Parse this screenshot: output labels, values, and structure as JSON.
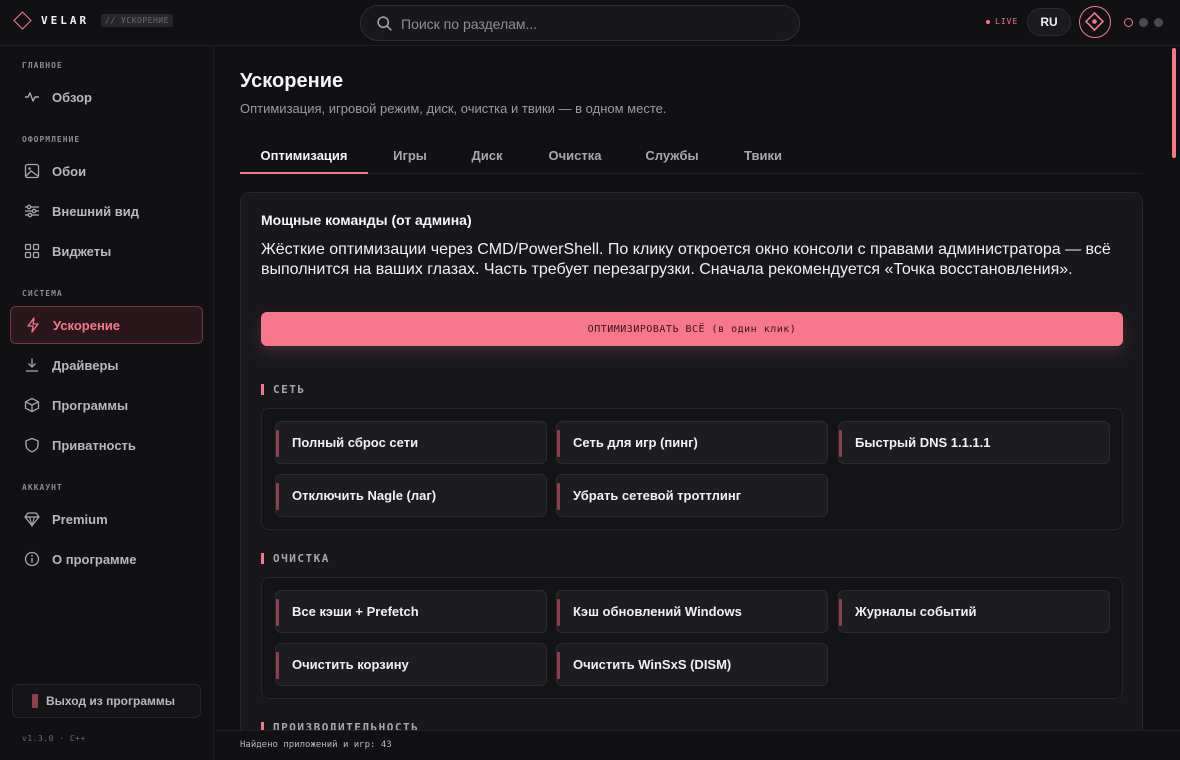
{
  "app": {
    "brand": "VELAR",
    "crumb": "// УСКОРЕНИЕ",
    "live": "LIVE",
    "language": "RU",
    "accent_color": "#f5788a"
  },
  "search": {
    "placeholder": "Поиск по разделам..."
  },
  "sidebar": {
    "sections": [
      {
        "title": "ГЛАВНОЕ",
        "items": [
          {
            "label": "Обзор",
            "icon": "activity-icon"
          }
        ]
      },
      {
        "title": "ОФОРМЛЕНИЕ",
        "items": [
          {
            "label": "Обои",
            "icon": "image-icon"
          },
          {
            "label": "Внешний вид",
            "icon": "sliders-icon"
          },
          {
            "label": "Виджеты",
            "icon": "grid-icon"
          }
        ]
      },
      {
        "title": "СИСТЕМА",
        "items": [
          {
            "label": "Ускорение",
            "icon": "lightning-icon",
            "active": true
          },
          {
            "label": "Драйверы",
            "icon": "download-icon"
          },
          {
            "label": "Программы",
            "icon": "box-icon"
          },
          {
            "label": "Приватность",
            "icon": "shield-icon"
          }
        ]
      },
      {
        "title": "АККАУНТ",
        "items": [
          {
            "label": "Premium",
            "icon": "diamond-icon"
          },
          {
            "label": "О программе",
            "icon": "info-icon"
          }
        ]
      }
    ],
    "exit_label": "Выход из программы",
    "version": "v1.3.0 · C++"
  },
  "main": {
    "title": "Ускорение",
    "subtitle": "Оптимизация, игровой режим, диск, очистка и твики — в одном месте.",
    "tabs": [
      {
        "label": "Оптимизация",
        "active": true
      },
      {
        "label": "Игры"
      },
      {
        "label": "Диск"
      },
      {
        "label": "Очистка"
      },
      {
        "label": "Службы"
      },
      {
        "label": "Твики"
      }
    ],
    "card": {
      "title": "Мощные команды (от админа)",
      "description": "Жёсткие оптимизации через CMD/PowerShell. По клику откроется окно консоли с правами администратора — всё выполнится на ваших глазах. Часть требует перезагрузки. Сначала рекомендуется «Точка восстановления».",
      "optimize_all_label": "ОПТИМИЗИРОВАТЬ ВСЁ (в один клик)",
      "groups": [
        {
          "title": "СЕТЬ",
          "commands": [
            "Полный сброс сети",
            "Сеть для игр (пинг)",
            "Быстрый DNS 1.1.1.1",
            "Отключить Nagle (лаг)",
            "Убрать сетевой троттлинг"
          ]
        },
        {
          "title": "ОЧИСТКА",
          "commands": [
            "Все кэши + Prefetch",
            "Кэш обновлений Windows",
            "Журналы событий",
            "Очистить корзину",
            "Очистить WinSxS (DISM)"
          ]
        },
        {
          "title": "ПРОИЗВОДИТЕЛЬНОСТЬ",
          "commands": []
        }
      ]
    }
  },
  "footer": {
    "status": "Найдено приложений и игр: 43"
  }
}
